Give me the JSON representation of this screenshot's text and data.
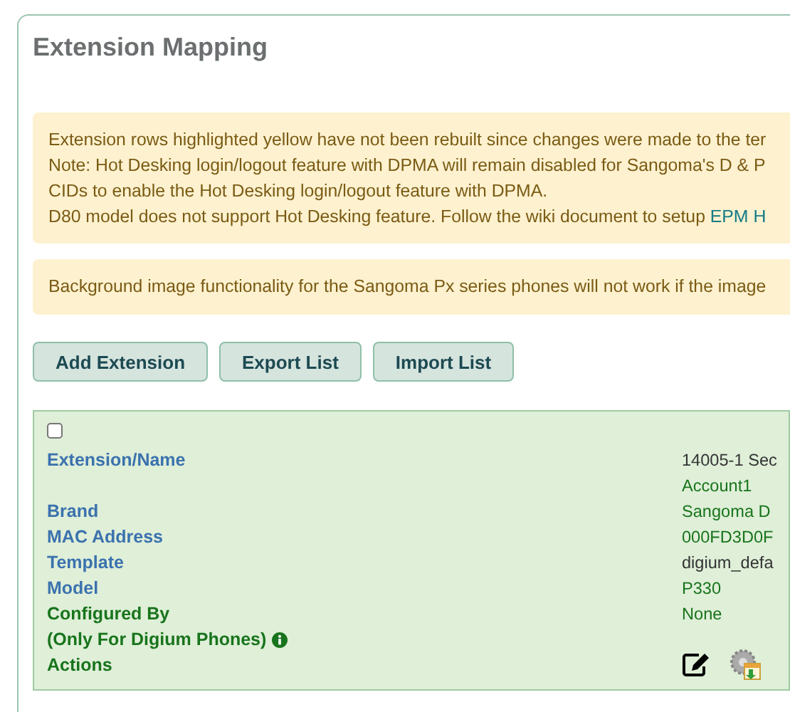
{
  "card": {
    "title": "Extension Mapping",
    "alerts": [
      {
        "lines": [
          {
            "text": "Extension rows highlighted yellow have not been rebuilt since changes were made to the ter"
          },
          {
            "text": "Note: Hot Desking login/logout feature with DPMA will remain disabled for Sangoma's D & P"
          },
          {
            "text": "CIDs to enable the Hot Desking login/logout feature with DPMA."
          },
          {
            "text": "D80 model does not support Hot Desking feature. Follow the wiki document to setup ",
            "link": "EPM H"
          }
        ]
      },
      {
        "lines": [
          {
            "text": "Background image functionality for the Sangoma Px series phones will not work if the image"
          }
        ]
      }
    ],
    "buttons": [
      "Add Extension",
      "Export List",
      "Import List"
    ],
    "extension": {
      "checked": false,
      "rows": [
        {
          "label": "Extension/Name",
          "color": "#3b72ae",
          "values": [
            {
              "text": "14005-1 Sec",
              "kind": "plain"
            },
            {
              "text": "Account1",
              "kind": "link"
            }
          ]
        },
        {
          "label": "Brand",
          "color": "#3b72ae",
          "values": [
            {
              "text": "Sangoma D",
              "kind": "link"
            }
          ]
        },
        {
          "label": "MAC Address",
          "color": "#3b72ae",
          "values": [
            {
              "text": "000FD3D0F",
              "kind": "link"
            }
          ]
        },
        {
          "label": "Template",
          "color": "#3b72ae",
          "values": [
            {
              "text": "digium_defa",
              "kind": "plain"
            }
          ]
        },
        {
          "label": "Model",
          "color": "#3b72ae",
          "values": [
            {
              "text": "P330",
              "kind": "link"
            }
          ]
        },
        {
          "label": "Configured By",
          "color": "#18741c",
          "note": "(Only For Digium Phones)",
          "values": [
            {
              "text": "None",
              "kind": "link"
            }
          ]
        },
        {
          "label": "Actions",
          "color": "#18741c",
          "actions": [
            {
              "kind": "edit"
            },
            {
              "kind": "deploy"
            }
          ]
        }
      ]
    }
  }
}
